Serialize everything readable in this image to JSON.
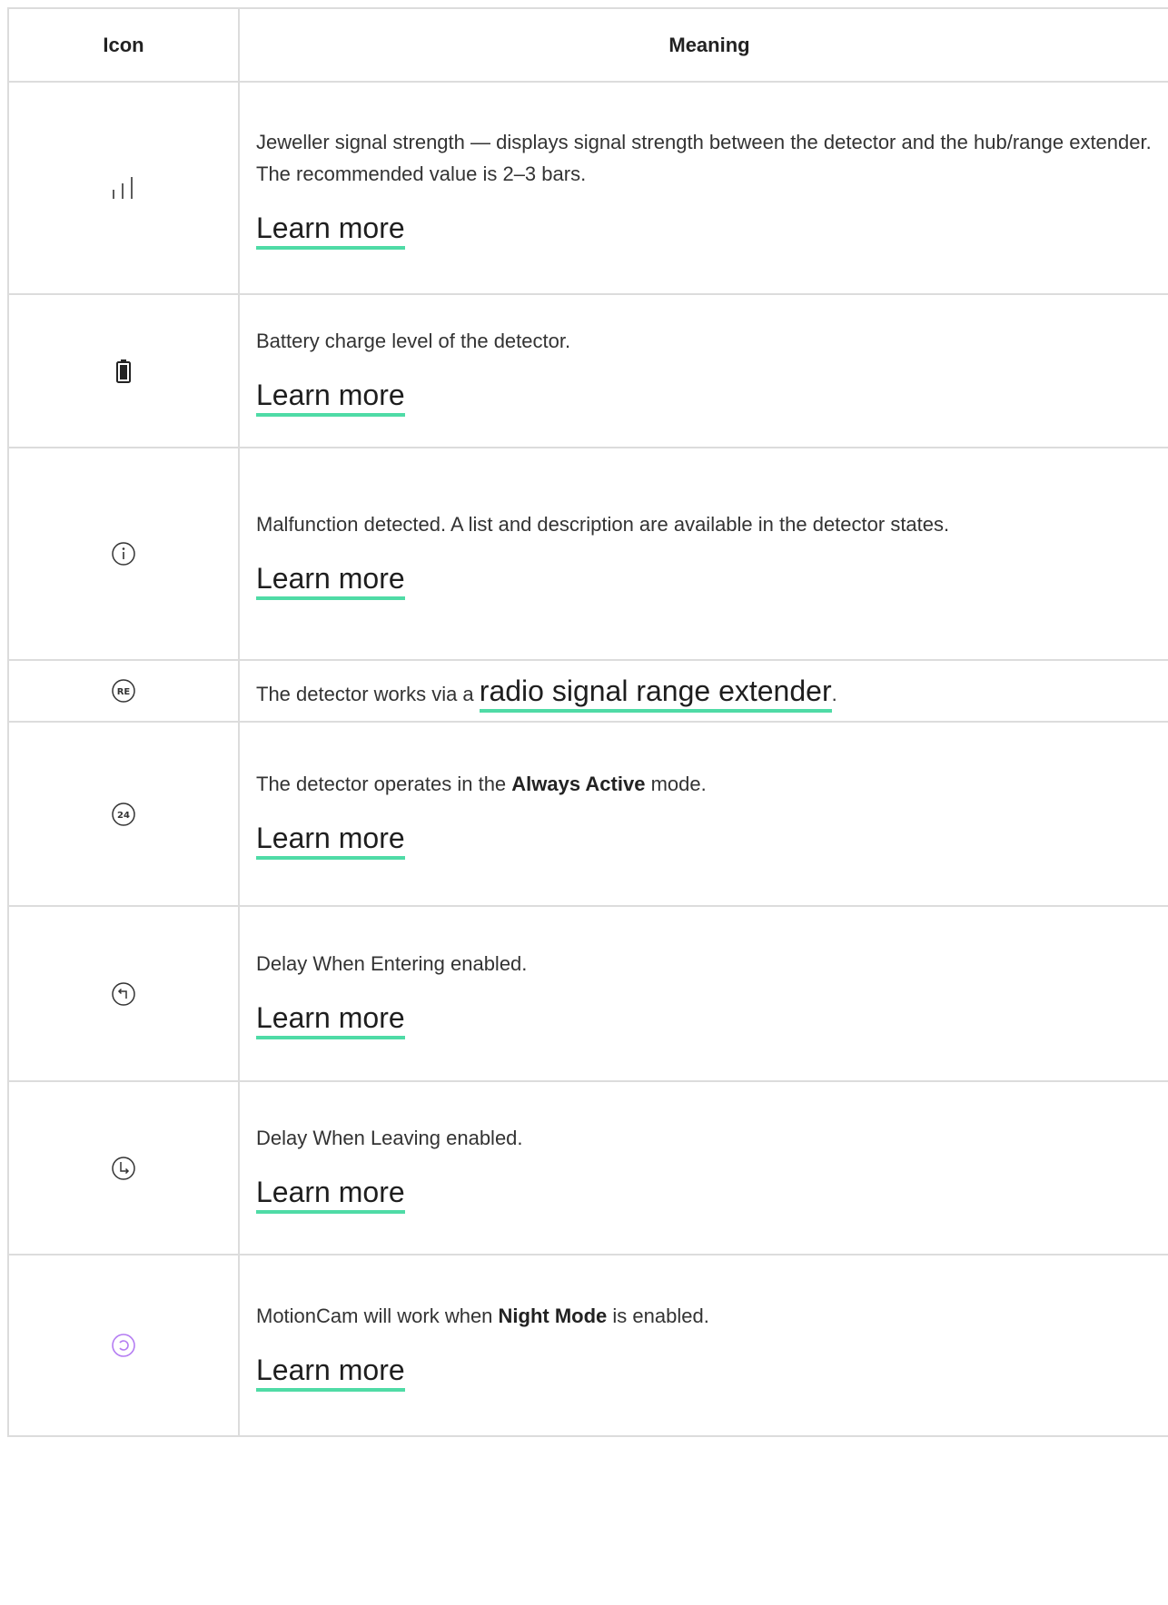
{
  "table": {
    "headers": {
      "icon": "Icon",
      "meaning": "Meaning"
    },
    "rows": [
      {
        "icon": "signal-strength-icon",
        "text": "Jeweller signal strength — displays signal strength between the detector and the hub/range extender. The recommended value is 2–3 bars.",
        "link": "Learn more"
      },
      {
        "icon": "battery-icon",
        "text": "Battery charge level of the detector.",
        "link": "Learn more"
      },
      {
        "icon": "info-icon",
        "text": "Malfunction detected. A list and description are available in the detector states.",
        "link": "Learn more"
      },
      {
        "icon": "range-extender-icon",
        "icon_text": "RE",
        "text_before": "The detector works via a ",
        "link": "radio signal range extender",
        "text_after": "."
      },
      {
        "icon": "always-active-icon",
        "icon_text": "24",
        "text_before": "The detector operates in the ",
        "bold": "Always Active",
        "text_after": " mode.",
        "link": "Learn more"
      },
      {
        "icon": "delay-entering-icon",
        "text": "Delay When Entering enabled.",
        "link": "Learn more"
      },
      {
        "icon": "delay-leaving-icon",
        "text": "Delay When Leaving enabled.",
        "link": "Learn more"
      },
      {
        "icon": "night-mode-icon",
        "text_before": "MotionCam will work when ",
        "bold": "Night Mode",
        "text_after": " is enabled.",
        "link": "Learn more"
      }
    ]
  },
  "colors": {
    "link_underline": "#4fdba6",
    "border": "#dcdcdc",
    "night_mode_icon": "#b47cf2"
  }
}
